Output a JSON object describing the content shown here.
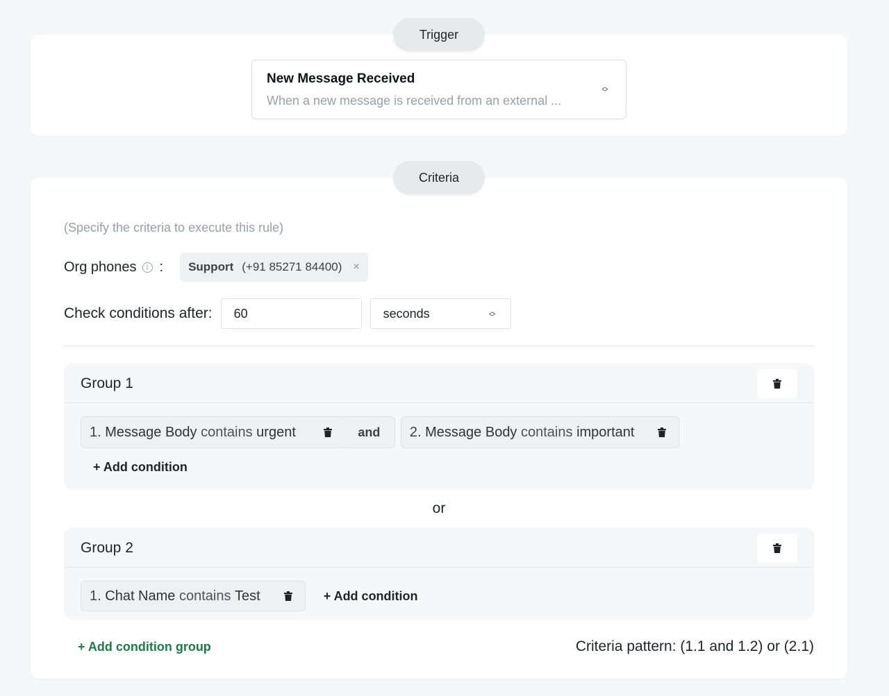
{
  "trigger": {
    "section_label": "Trigger",
    "selected_title": "New Message Received",
    "selected_description": "When a new message is received from an external ..."
  },
  "criteria": {
    "section_label": "Criteria",
    "hint": "(Specify the criteria to execute this rule)",
    "org_phones": {
      "label": "Org phones",
      "colon": ":",
      "tags": [
        {
          "name": "Support",
          "phone": "(+91 85271 84400)",
          "remove": "×"
        }
      ]
    },
    "check_after": {
      "label": "Check conditions after:",
      "value": "60",
      "unit": "seconds"
    },
    "groups": [
      {
        "title": "Group 1",
        "conditions": [
          {
            "index": "1.",
            "field": "Message Body",
            "operator": "contains",
            "value": "urgent"
          },
          {
            "index": "2.",
            "field": "Message Body",
            "operator": "contains",
            "value": "important"
          }
        ],
        "joiner": "and",
        "add_condition": "+ Add condition"
      },
      {
        "title": "Group 2",
        "conditions": [
          {
            "index": "1.",
            "field": "Chat Name",
            "operator": "contains",
            "value": "Test"
          }
        ],
        "add_condition": "+ Add condition"
      }
    ],
    "group_joiner": "or",
    "add_group": "+ Add condition group",
    "pattern": "Criteria pattern: (1.1 and 1.2) or (2.1)"
  },
  "colors": {
    "accent_green": "#1e7a46",
    "page_bg": "#f6f7f9"
  },
  "icons": [
    "chevron-updown-icon",
    "info-icon",
    "close-icon",
    "trash-icon"
  ]
}
